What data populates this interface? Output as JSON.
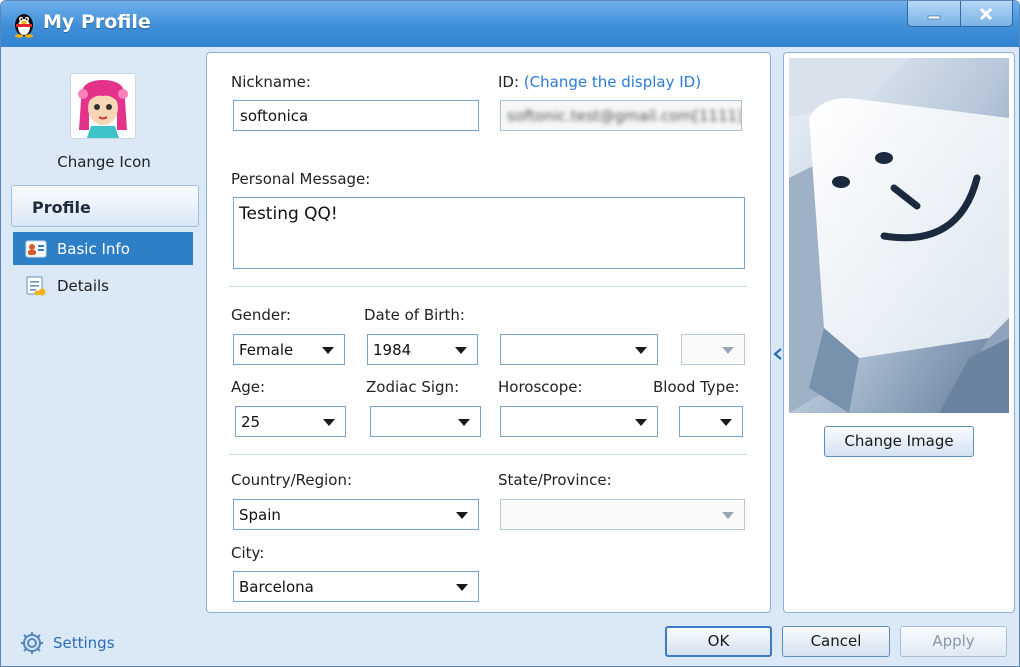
{
  "window": {
    "title": "My Profile",
    "minimize_glyph": "_",
    "close_glyph": "X"
  },
  "sidebar": {
    "change_icon_label": "Change Icon",
    "section_title": "Profile",
    "items": [
      {
        "label": "Basic Info",
        "icon": "id-card-icon",
        "active": true
      },
      {
        "label": "Details",
        "icon": "details-icon",
        "active": false
      }
    ]
  },
  "form": {
    "nickname_label": "Nickname:",
    "nickname_value": "softonica",
    "id_label": "ID: ",
    "id_link": "(Change the display ID)",
    "id_value": "softonic.test@gmail.com[1111]",
    "personal_message_label": "Personal Message:",
    "personal_message_value": "Testing QQ!",
    "gender_label": "Gender:",
    "gender_value": "Female",
    "dob_label": "Date of Birth:",
    "dob_year": "1984",
    "dob_month": "",
    "dob_day": "",
    "age_label": "Age:",
    "age_value": "25",
    "zodiac_label": "Zodiac Sign:",
    "zodiac_value": "",
    "horoscope_label": "Horoscope:",
    "horoscope_value": "",
    "blood_label": "Blood Type:",
    "blood_value": "",
    "country_label": "Country/Region:",
    "country_value": "Spain",
    "state_label": "State/Province:",
    "state_value": "",
    "city_label": "City:",
    "city_value": "Barcelona"
  },
  "right_panel": {
    "change_image_label": "Change Image",
    "image": "keyboard-smiley-key"
  },
  "footer": {
    "settings_label": "Settings",
    "ok_label": "OK",
    "cancel_label": "Cancel",
    "apply_label": "Apply"
  },
  "colors": {
    "title_bar": "#3f8fd8",
    "selected_nav": "#2f7fc6",
    "link": "#2b7bd4",
    "panel_bg": "#dbe9f7"
  }
}
